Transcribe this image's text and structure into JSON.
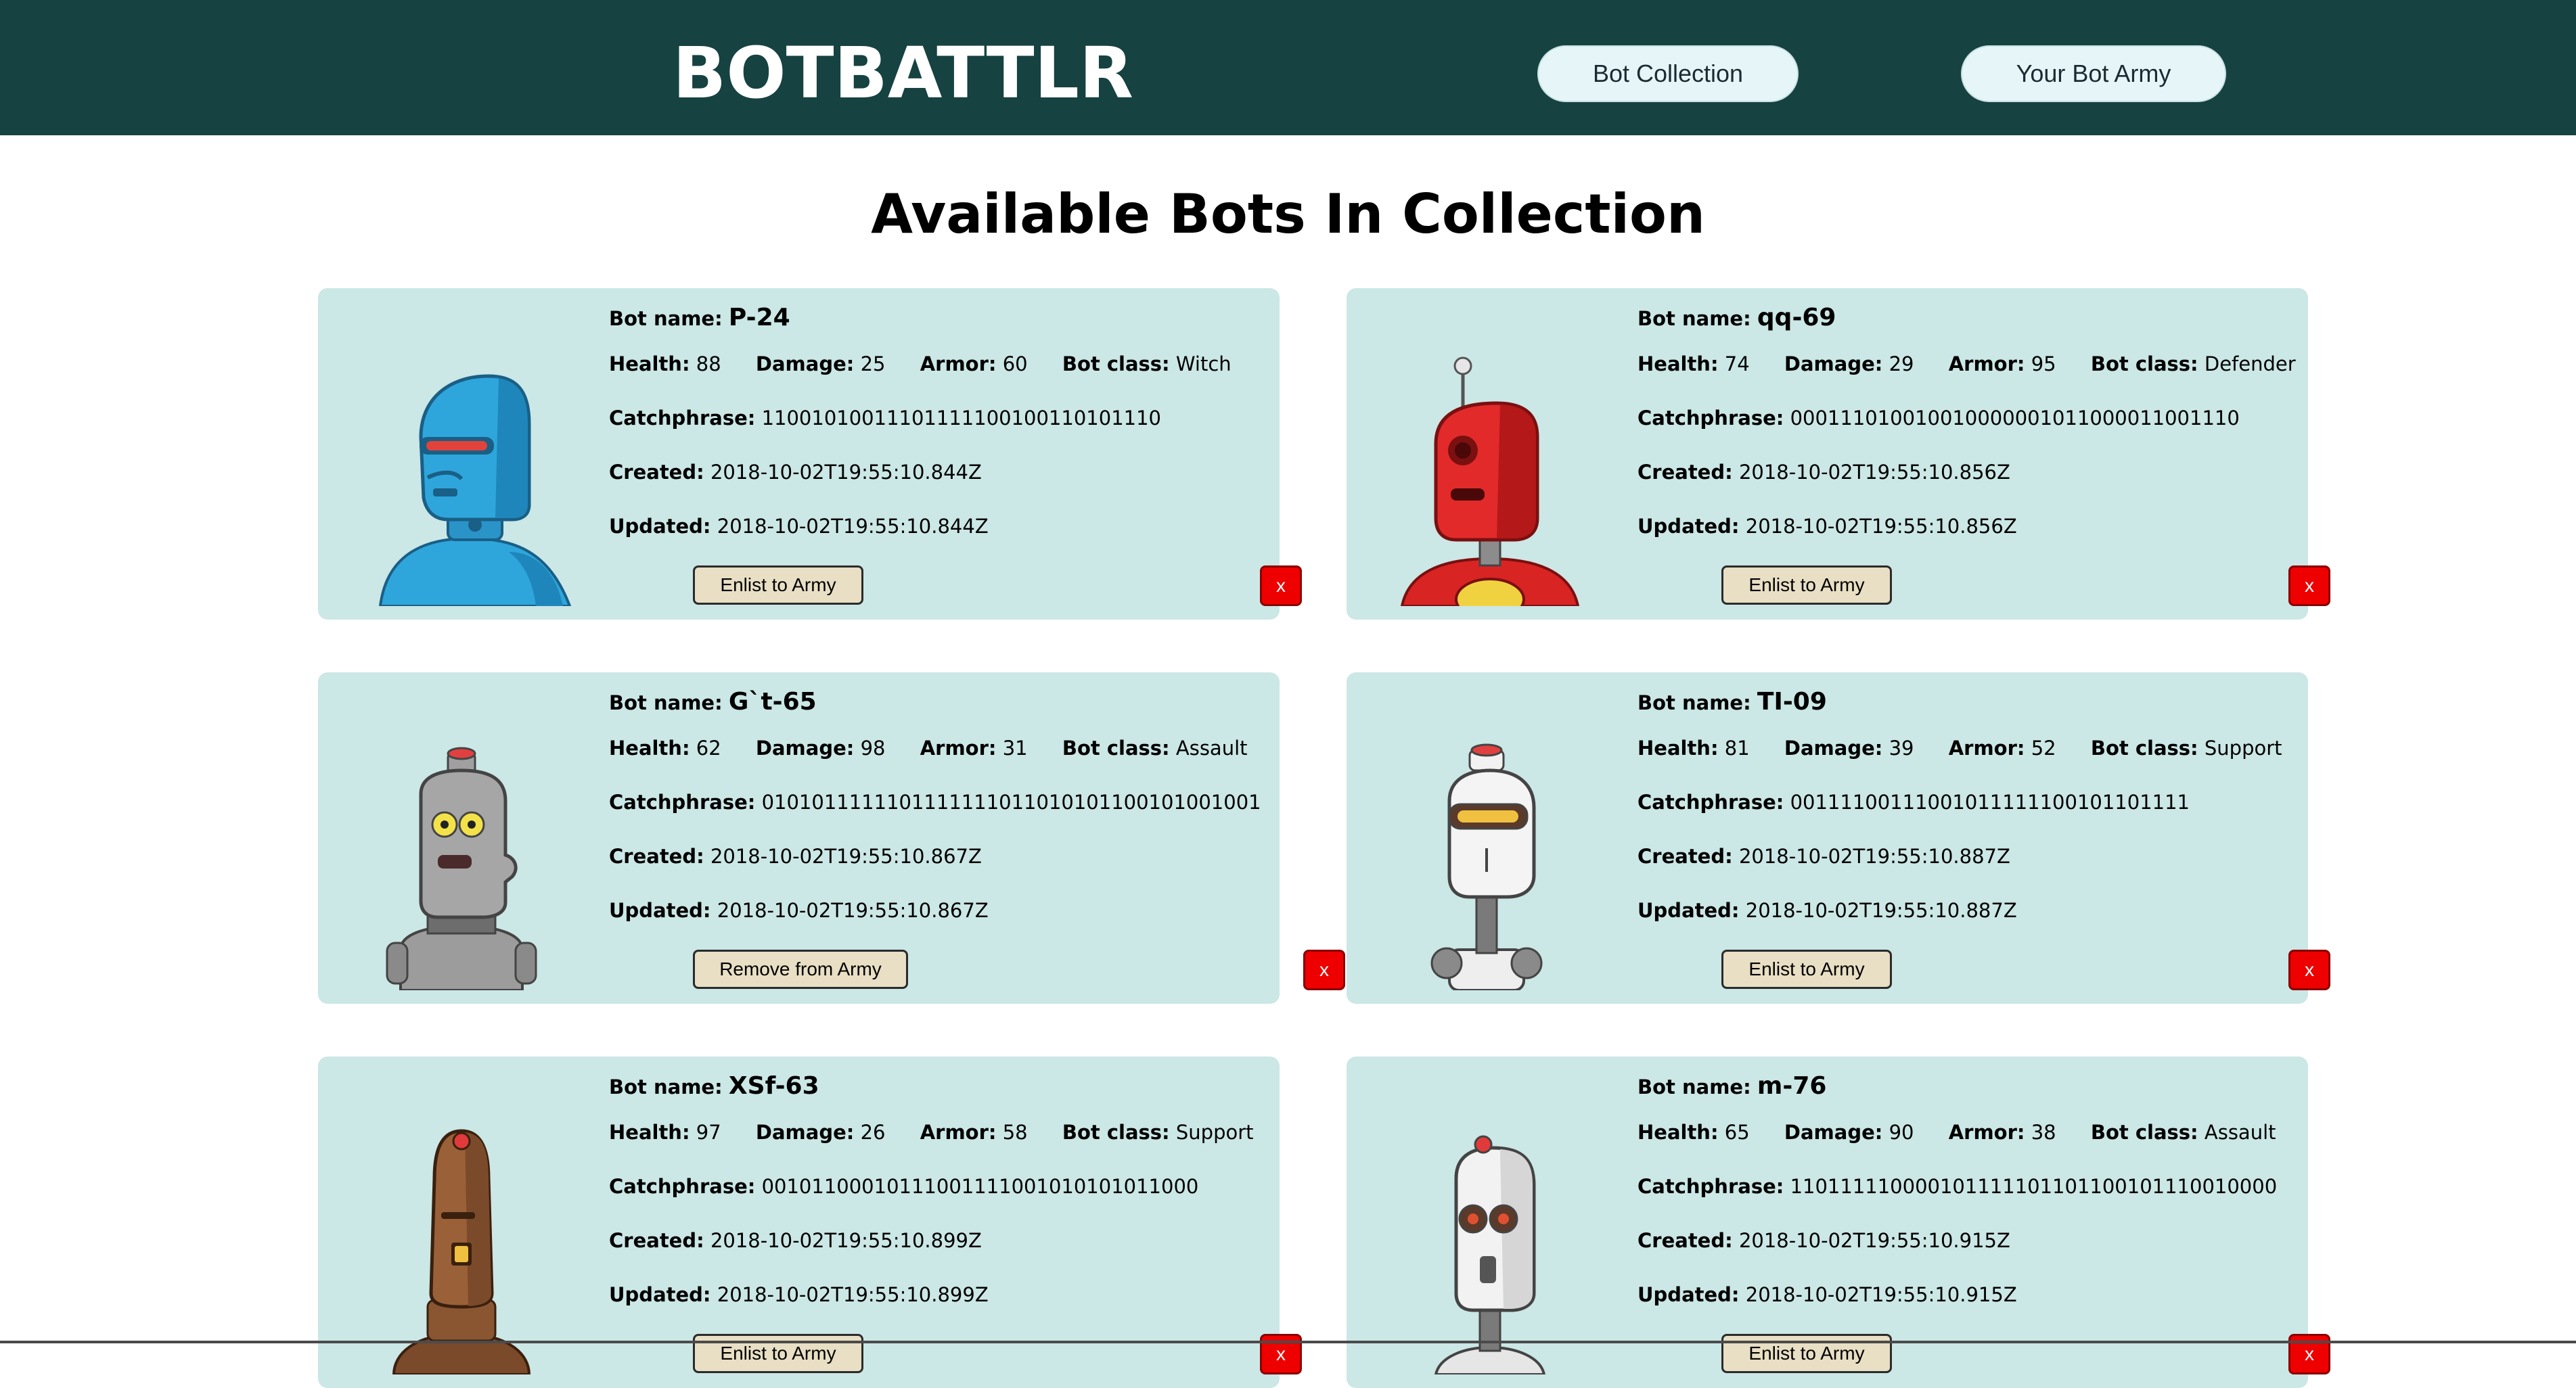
{
  "header": {
    "brand": "BOTBATTLR",
    "nav": {
      "collection": "Bot Collection",
      "army": "Your Bot Army"
    }
  },
  "page_title": "Available Bots In Collection",
  "labels": {
    "bot_name": "Bot name:",
    "health": "Health:",
    "damage": "Damage:",
    "armor": "Armor:",
    "bot_class": "Bot class:",
    "catchphrase": "Catchphrase:",
    "created": "Created:",
    "updated": "Updated:",
    "delete": "x"
  },
  "colors": {
    "header_bg": "#164241",
    "card_bg": "#cbe7e6",
    "nav_button_bg": "#e6f6f8",
    "action_button_bg": "#e8dfc4",
    "delete_button_bg": "#ee0000"
  },
  "bots": [
    {
      "name": "P-24",
      "health": "88",
      "damage": "25",
      "armor": "60",
      "bot_class": "Witch",
      "catchphrase": "11001010011101111100100110101110",
      "created": "2018-10-02T19:55:10.844Z",
      "updated": "2018-10-02T19:55:10.844Z",
      "action": "Enlist to Army",
      "avatar_icon": "blue-robot-avatar"
    },
    {
      "name": "qq-69",
      "health": "74",
      "damage": "29",
      "armor": "95",
      "bot_class": "Defender",
      "catchphrase": "000111010010010000001011000011001110",
      "created": "2018-10-02T19:55:10.856Z",
      "updated": "2018-10-02T19:55:10.856Z",
      "action": "Enlist to Army",
      "avatar_icon": "red-robot-avatar"
    },
    {
      "name": "G`t-65",
      "health": "62",
      "damage": "98",
      "armor": "31",
      "bot_class": "Assault",
      "catchphrase": "0101011111101111111011010101100101001001",
      "created": "2018-10-02T19:55:10.867Z",
      "updated": "2018-10-02T19:55:10.867Z",
      "action": "Remove from Army",
      "avatar_icon": "grey-robot-avatar"
    },
    {
      "name": "TI-09",
      "health": "81",
      "damage": "39",
      "armor": "52",
      "bot_class": "Support",
      "catchphrase": "00111100111001011111100101101111",
      "created": "2018-10-02T19:55:10.887Z",
      "updated": "2018-10-02T19:55:10.887Z",
      "action": "Enlist to Army",
      "avatar_icon": "white-robot-avatar"
    },
    {
      "name": "XSf-63",
      "health": "97",
      "damage": "26",
      "armor": "58",
      "bot_class": "Support",
      "catchphrase": "00101100010111001111001010101011000",
      "created": "2018-10-02T19:55:10.899Z",
      "updated": "2018-10-02T19:55:10.899Z",
      "action": "Enlist to Army",
      "avatar_icon": "brown-robot-avatar"
    },
    {
      "name": "m-76",
      "health": "65",
      "damage": "90",
      "armor": "38",
      "bot_class": "Assault",
      "catchphrase": "110111110000101111101101100101110010000",
      "created": "2018-10-02T19:55:10.915Z",
      "updated": "2018-10-02T19:55:10.915Z",
      "action": "Enlist to Army",
      "avatar_icon": "white-red-robot-avatar"
    }
  ]
}
